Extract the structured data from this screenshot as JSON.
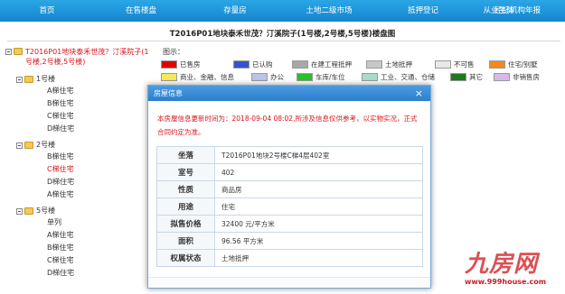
{
  "nav": {
    "items": [
      {
        "label": "首页",
        "w": 104
      },
      {
        "label": "在售楼盘",
        "w": 104
      },
      {
        "label": "存量房",
        "w": 104
      },
      {
        "label": "土地二级市场",
        "w": 104
      },
      {
        "label": "抵押登记",
        "w": 104
      },
      {
        "label": "经纪机构年报",
        "w": 105
      }
    ],
    "last_item": "从业主体"
  },
  "page": {
    "title": "T2016P01地块泰禾世茂？汀溪院子(1号楼,2号楼,5号楼)楼盘图"
  },
  "tree": {
    "root_label": "T2016P01地块泰禾世茂？汀溪院子(1号楼,2号楼,5号楼)",
    "groups": [
      {
        "label": "1号楼",
        "units": [
          "A梯住宅",
          "B梯住宅",
          "C梯住宅",
          "D梯住宅"
        ]
      },
      {
        "label": "2号楼",
        "units": [
          "B梯住宅",
          "C梯住宅",
          "D梯住宅",
          "A梯住宅"
        ]
      },
      {
        "label": "5号楼",
        "units": [
          "单列",
          "A梯住宅",
          "B梯住宅",
          "C梯住宅",
          "D梯住宅"
        ]
      }
    ],
    "active": {
      "group": 1,
      "unit": 1
    }
  },
  "legend": {
    "title": "图示：",
    "row1": [
      {
        "label": "已售房",
        "color": "#e00000"
      },
      {
        "label": "已认购",
        "color": "#3355cc"
      },
      {
        "label": "在建工程抵押",
        "color": "#a8a8a8"
      },
      {
        "label": "土地抵押",
        "color": "#c8c8c8"
      },
      {
        "label": "不可售",
        "color": "#e8e8e8"
      },
      {
        "label": "住宅/别墅",
        "color": "#f08a20"
      }
    ],
    "row2": [
      {
        "label": "商业、金融、信息",
        "color": "#f3ea5a"
      },
      {
        "label": "办公",
        "color": "#b9c4e8"
      },
      {
        "label": "车库/车位",
        "color": "#2bbf2b"
      },
      {
        "label": "工业、交通、仓储",
        "color": "#a6dcc8"
      },
      {
        "label": "其它",
        "color": "#1e7a1e"
      },
      {
        "label": "非销售房",
        "color": "#d9b8e8"
      }
    ]
  },
  "modal": {
    "title": "房屋信息",
    "close": "×",
    "notice": "本房屋信息更新时间为：2018-09-04 08:02,所涉及信息仅供参考，以实物实况，正式合同约定为准。",
    "rows": [
      {
        "key": "坐落",
        "value": "T2016P01地块2号楼C梯4层402室"
      },
      {
        "key": "室号",
        "value": "402"
      },
      {
        "key": "性质",
        "value": "商品房"
      },
      {
        "key": "用途",
        "value": "住宅"
      },
      {
        "key": "拟售价格",
        "value": "32400 元/平方米"
      },
      {
        "key": "面积",
        "value": "96.56 平方米"
      },
      {
        "key": "权属状态",
        "value": "土地抵押"
      }
    ]
  },
  "watermark": {
    "logo": "九房网",
    "url": "www.999house.com"
  }
}
